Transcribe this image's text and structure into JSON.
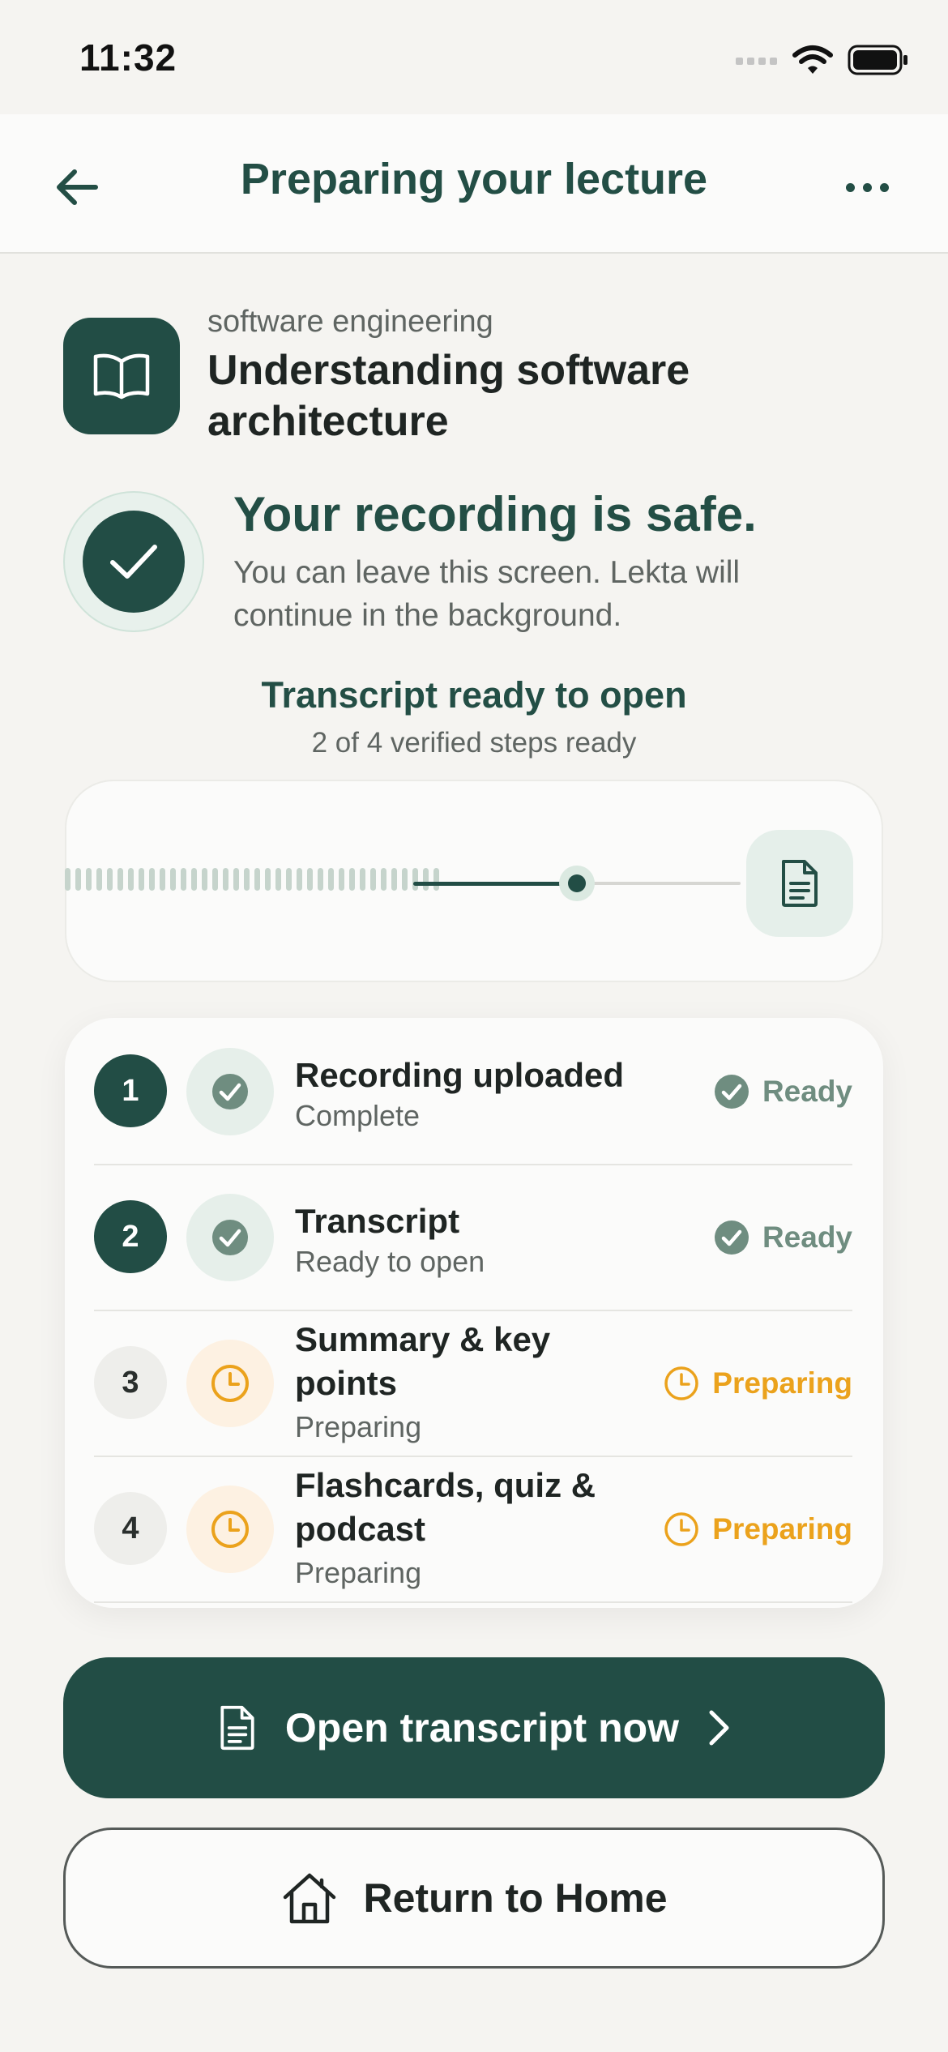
{
  "status_bar": {
    "time": "11:32"
  },
  "nav": {
    "title": "Preparing your lecture"
  },
  "lecture": {
    "subject": "software engineering",
    "title": "Understanding software architecture"
  },
  "safe_banner": {
    "title": "Your recording is safe.",
    "body": "You can leave this screen. Lekta will continue in the background."
  },
  "transcript_status": {
    "title": "Transcript ready to open",
    "subtitle": "2 of 4 verified steps ready"
  },
  "progress": {
    "fraction": 0.5
  },
  "steps": [
    {
      "number": "1",
      "title": "Recording uploaded",
      "subtitle": "Complete",
      "status": "Ready",
      "state": "done"
    },
    {
      "number": "2",
      "title": "Transcript",
      "subtitle": "Ready to open",
      "status": "Ready",
      "state": "done"
    },
    {
      "number": "3",
      "title": "Summary & key points",
      "subtitle": "Preparing",
      "status": "Preparing",
      "state": "pending"
    },
    {
      "number": "4",
      "title": "Flashcards, quiz & podcast",
      "subtitle": "Preparing",
      "status": "Preparing",
      "state": "pending"
    }
  ],
  "actions": {
    "primary_label": "Open transcript now",
    "secondary_label": "Return to Home"
  },
  "colors": {
    "brand": "#224d45",
    "ready": "#6f8d80",
    "preparing": "#eba21c",
    "background": "#f5f4f1"
  },
  "icons": {
    "back": "arrow-left-icon",
    "more": "ellipsis-icon",
    "book": "book-open-icon",
    "check": "checkmark-icon",
    "document": "document-icon",
    "clock": "clock-icon",
    "chevron": "chevron-right-icon",
    "home": "home-icon"
  }
}
